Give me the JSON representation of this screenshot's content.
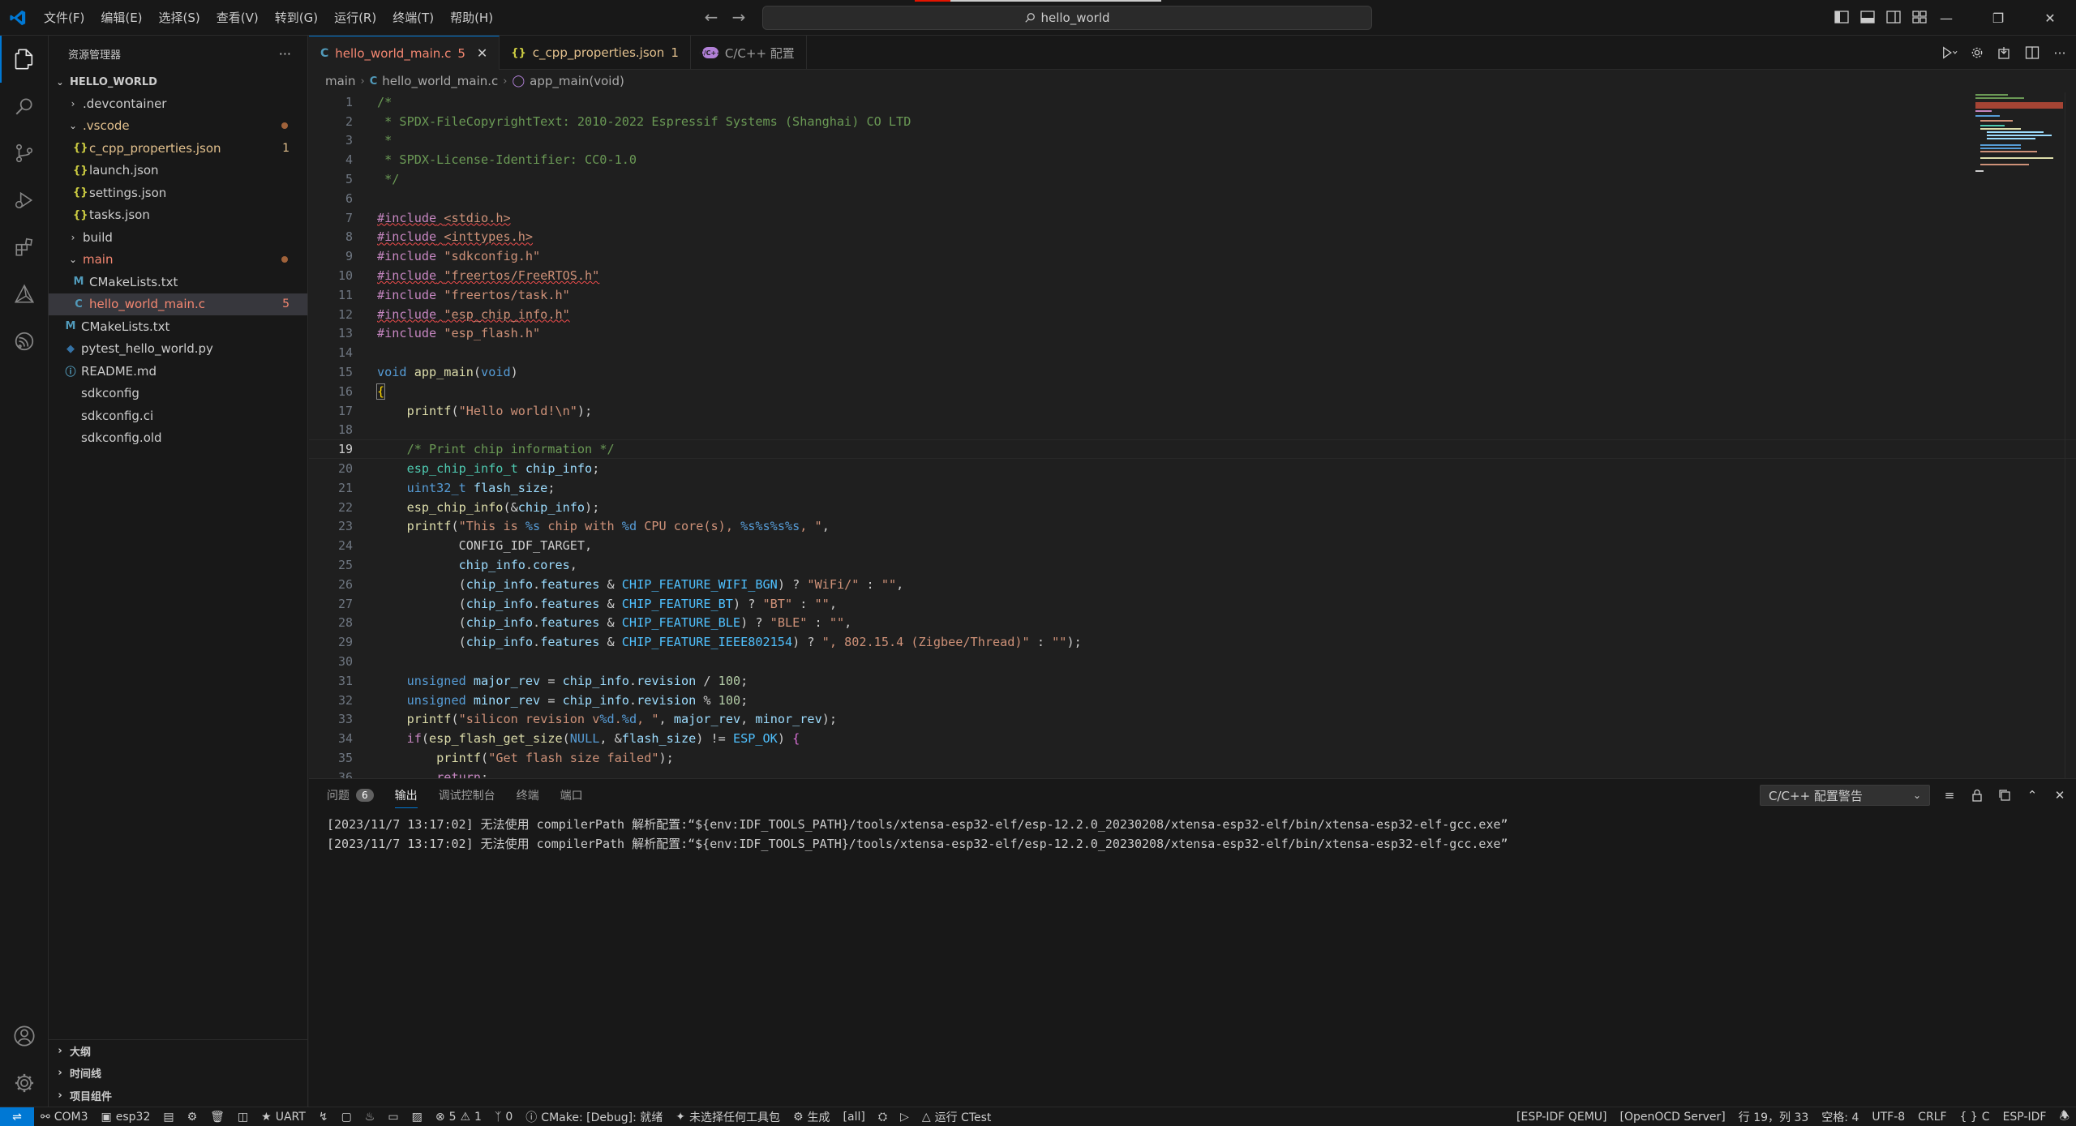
{
  "titlebar": {
    "menu": [
      "文件(F)",
      "编辑(E)",
      "选择(S)",
      "查看(V)",
      "转到(G)",
      "运行(R)",
      "终端(T)",
      "帮助(H)"
    ],
    "search_text": "hello_world",
    "back_glyph": "←",
    "forward_glyph": "→"
  },
  "sidebar": {
    "title": "资源管理器",
    "more": "···",
    "root": "HELLO_WORLD",
    "items": [
      {
        "label": ".devcontainer"
      },
      {
        "label": ".vscode"
      },
      {
        "label": "c_cpp_properties.json",
        "badge": "1"
      },
      {
        "label": "launch.json"
      },
      {
        "label": "settings.json"
      },
      {
        "label": "tasks.json"
      },
      {
        "label": "build"
      },
      {
        "label": "main"
      },
      {
        "label": "CMakeLists.txt"
      },
      {
        "label": "hello_world_main.c",
        "badge": "5"
      },
      {
        "label": "CMakeLists.txt"
      },
      {
        "label": "pytest_hello_world.py"
      },
      {
        "label": "README.md"
      },
      {
        "label": "sdkconfig"
      },
      {
        "label": "sdkconfig.ci"
      },
      {
        "label": "sdkconfig.old"
      }
    ],
    "bottom_sections": [
      "大纲",
      "时间线",
      "项目组件"
    ]
  },
  "tabs": [
    {
      "label": "hello_world_main.c",
      "badge": "5",
      "icon": "C"
    },
    {
      "label": "c_cpp_properties.json",
      "badge": "1",
      "icon": "{}"
    },
    {
      "label": "C/C++ 配置",
      "icon": "C/C++"
    }
  ],
  "breadcrumb": {
    "folder": "main",
    "file": "hello_world_main.c",
    "symbol": "app_main(void)"
  },
  "code": {
    "current_line": 19,
    "line_numbers": [
      "1",
      "2",
      "3",
      "4",
      "5",
      "6",
      "7",
      "8",
      "9",
      "10",
      "11",
      "12",
      "13",
      "14",
      "15",
      "16",
      "17",
      "18",
      "19",
      "20",
      "21",
      "22",
      "23",
      "24",
      "25",
      "26",
      "27",
      "28",
      "29",
      "30",
      "31",
      "32",
      "33",
      "34",
      "35",
      "36"
    ]
  },
  "panel": {
    "tabs": [
      "问题",
      "输出",
      "调试控制台",
      "终端",
      "端口"
    ],
    "problems_count": "6",
    "channel": "C/C++ 配置警告",
    "output_lines": [
      "[2023/11/7 13:17:02] 无法使用 compilerPath 解析配置:“${env:IDF_TOOLS_PATH}/tools/xtensa-esp32-elf/esp-12.2.0_20230208/xtensa-esp32-elf/bin/xtensa-esp32-elf-gcc.exe”",
      "[2023/11/7 13:17:02] 无法使用 compilerPath 解析配置:“${env:IDF_TOOLS_PATH}/tools/xtensa-esp32-elf/esp-12.2.0_20230208/xtensa-esp32-elf/bin/xtensa-esp32-elf-gcc.exe”"
    ]
  },
  "statusbar": {
    "port": "COM3",
    "target": "esp32",
    "uart": "UART",
    "errors": "5",
    "warnings": "1",
    "ports_count": "0",
    "cmake": "CMake: [Debug]: 就绪",
    "kit": "未选择任何工具包",
    "build": "生成",
    "all": "[all]",
    "ctest": "运行 CTest",
    "qemu": "[ESP-IDF QEMU]",
    "openocd": "[OpenOCD Server]",
    "position": "行 19，列 33",
    "spaces": "空格: 4",
    "encoding": "UTF-8",
    "eol": "CRLF",
    "language": "C",
    "espidf": "ESP-IDF"
  },
  "colors": {
    "accent": "#0078d4",
    "error": "#f48771",
    "background": "#1f1f1f"
  }
}
